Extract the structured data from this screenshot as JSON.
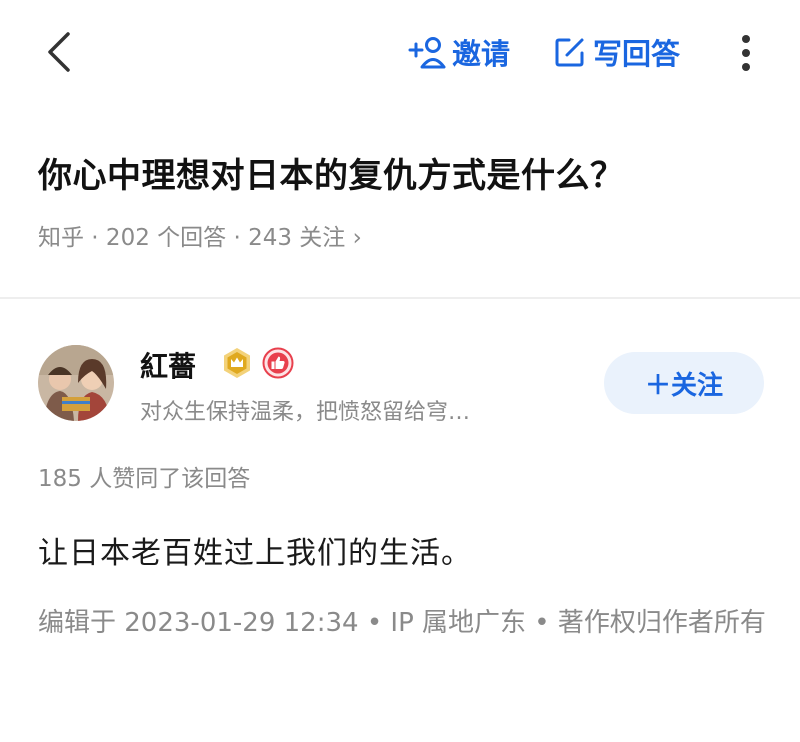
{
  "header": {
    "back_icon": "chevron-left-icon",
    "invite_label": "邀请",
    "invite_icon": "add-user-icon",
    "write_label": "写回答",
    "write_icon": "edit-icon",
    "more_icon": "more-vertical-icon"
  },
  "question": {
    "title": "你心中理想对日本的复仇方式是什么？",
    "meta": "知乎 · 202 个回答 · 243 关注 ›"
  },
  "answer": {
    "author": {
      "name": "紅薔",
      "bio": "对众生保持温柔，把愤怒留给穹…",
      "follow_label": "＋关注"
    },
    "upvote_text": "185 人赞同了该回答",
    "content": "让日本老百姓过上我们的生活。",
    "edit_info": "编辑于 2023-01-29 12:34 • IP 属地广东 • 著作权归作者所有"
  },
  "colors": {
    "accent": "#1a66e0",
    "follow_bg": "#eaf2fc",
    "meta_gray": "#8a8a8a",
    "badge_gold": "#e0a91f",
    "badge_red": "#e8404d"
  }
}
